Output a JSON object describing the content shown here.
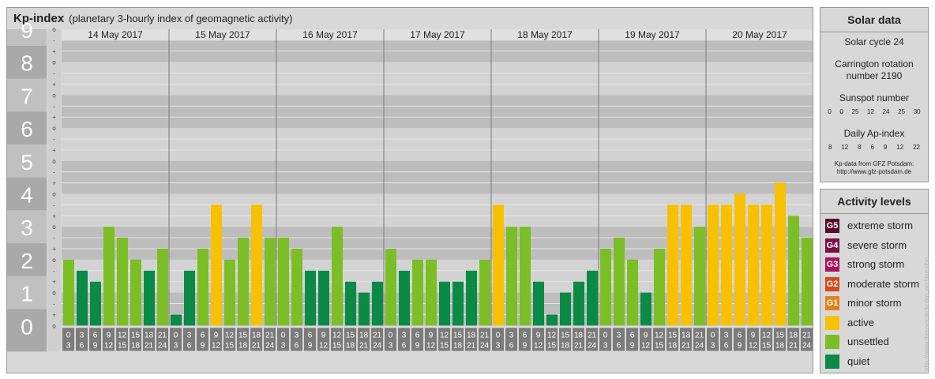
{
  "header": {
    "title": "Kp-index",
    "subtitle": "(planetary 3-hourly index of geomagnetic activity)"
  },
  "chart_data": {
    "type": "bar",
    "title": "Kp-index",
    "subtitle": "(planetary 3-hourly index of geomagnetic activity)",
    "ylim": [
      0,
      9
    ],
    "y_major_ticks": [
      "0",
      "1",
      "2",
      "3",
      "4",
      "5",
      "6",
      "7",
      "8",
      "9"
    ],
    "y_minor_ticks": [
      "o",
      "+",
      "-"
    ],
    "dates": [
      "14 May 2017",
      "15 May 2017",
      "16 May 2017",
      "17 May 2017",
      "18 May 2017",
      "19 May 2017",
      "20 May 2017"
    ],
    "hour_start": [
      "0",
      "3",
      "6",
      "9",
      "12",
      "15",
      "18",
      "21"
    ],
    "hour_end": [
      "3",
      "6",
      "9",
      "12",
      "15",
      "18",
      "21",
      "24"
    ],
    "values": [
      [
        2.0,
        1.667,
        1.333,
        3.0,
        2.667,
        2.0,
        1.667,
        2.333
      ],
      [
        0.333,
        1.667,
        2.333,
        3.667,
        2.0,
        2.667,
        3.667,
        2.667
      ],
      [
        2.667,
        2.333,
        1.667,
        1.667,
        3.0,
        1.333,
        1.0,
        1.333
      ],
      [
        2.333,
        1.667,
        2.0,
        2.0,
        1.333,
        1.333,
        1.667,
        2.0
      ],
      [
        3.667,
        3.0,
        3.0,
        1.333,
        0.333,
        1.0,
        1.333,
        1.667
      ],
      [
        2.333,
        2.667,
        2.0,
        1.0,
        2.333,
        3.667,
        3.667,
        3.0
      ],
      [
        3.667,
        3.667,
        4.0,
        3.667,
        3.667,
        4.333,
        3.333,
        2.667
      ]
    ],
    "colors": {
      "quiet": "#0a8a46",
      "unsettled": "#7cbe25",
      "active": "#f8c100"
    }
  },
  "solar": {
    "title": "Solar data",
    "cycle": "Solar cycle 24",
    "carrington_1": "Carrington rotation",
    "carrington_2": "number 2190",
    "sunspot_title": "Sunspot number",
    "sunspot_values": [
      "0",
      "0",
      "25",
      "12",
      "24",
      "25",
      "30"
    ],
    "ap_title": "Daily Ap-index",
    "ap_values": [
      "8",
      "12",
      "8",
      "6",
      "9",
      "12",
      "22"
    ],
    "source_1": "Kp-data from GFZ Potsdam:",
    "source_2": "http://www.gfz-potsdam.de"
  },
  "activity": {
    "title": "Activity levels",
    "levels": [
      {
        "badge": "G5",
        "label": "extreme storm",
        "color": "#5a0a2a"
      },
      {
        "badge": "G4",
        "label": "severe storm",
        "color": "#7a1044"
      },
      {
        "badge": "G3",
        "label": "strong storm",
        "color": "#b0105a"
      },
      {
        "badge": "G2",
        "label": "moderate storm",
        "color": "#d84a1a"
      },
      {
        "badge": "G1",
        "label": "minor storm",
        "color": "#e8801a"
      },
      {
        "badge": "",
        "label": "active",
        "color": "#f8c100"
      },
      {
        "badge": "",
        "label": "unsettled",
        "color": "#7cbe25"
      },
      {
        "badge": "",
        "label": "quiet",
        "color": "#0a8a46"
      }
    ]
  },
  "credit": "http://www.theuser.de/kp/kp_archive.php"
}
